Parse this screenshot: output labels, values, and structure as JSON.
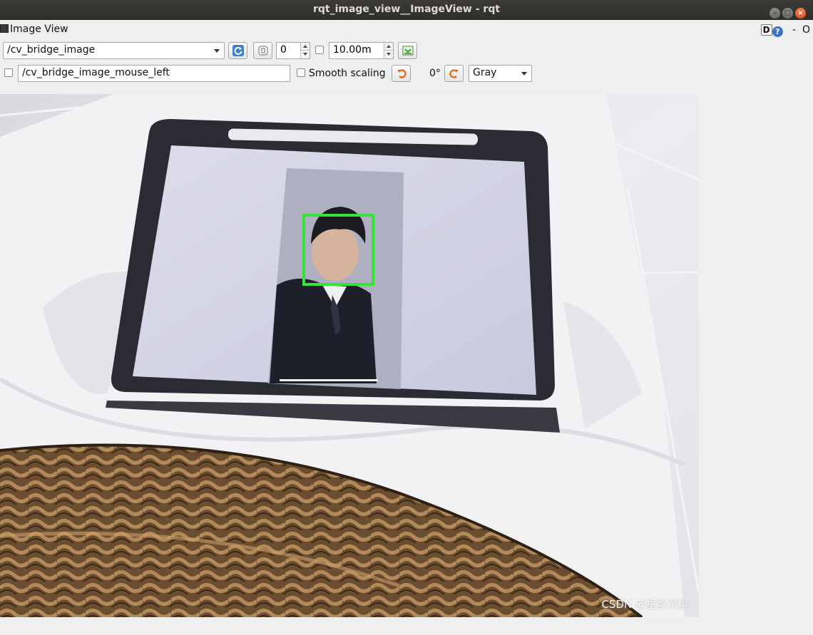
{
  "window": {
    "title": "rqt_image_view__ImageView - rqt"
  },
  "dock": {
    "title": "Image View",
    "help_btn": "D",
    "help_icon": "?",
    "minus": "-",
    "close": "O"
  },
  "toolbar": {
    "topic": "/cv_bridge_image",
    "spin_value": "0",
    "max_range": "10.00m",
    "mouse_topic": "/cv_bridge_image_mouse_left",
    "smooth_scaling_label": "Smooth scaling",
    "rotation": "0°",
    "color_scheme": "Gray"
  },
  "icons": {
    "refresh": "refresh-icon",
    "fit": "zoom-fit-icon",
    "save": "save-image-icon",
    "rotate_left": "rotate-left-icon",
    "rotate_right": "rotate-right-icon"
  },
  "image": {
    "watermark": "CSDN @星影沉璧"
  }
}
